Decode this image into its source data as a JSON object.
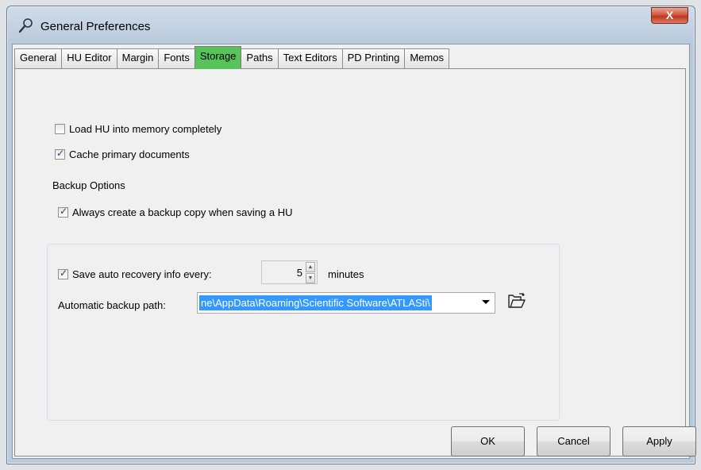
{
  "window": {
    "title": "General Preferences",
    "close_label": "X"
  },
  "tabs": [
    {
      "label": "General"
    },
    {
      "label": "HU Editor"
    },
    {
      "label": "Margin"
    },
    {
      "label": "Fonts"
    },
    {
      "label": "Storage",
      "active": true
    },
    {
      "label": "Paths"
    },
    {
      "label": "Text Editors"
    },
    {
      "label": "PD Printing"
    },
    {
      "label": "Memos"
    }
  ],
  "storage": {
    "load_hu": {
      "label": "Load HU into memory completely",
      "checked": false
    },
    "cache_docs": {
      "label": "Cache primary documents",
      "checked": true
    },
    "backup_group_label": "Backup Options",
    "always_backup": {
      "label": "Always create a backup copy when saving a HU",
      "checked": true
    },
    "auto_recovery": {
      "label": "Save auto recovery info every:",
      "checked": true
    },
    "auto_recovery_value": "5",
    "auto_recovery_unit": "minutes",
    "backup_path_label": "Automatic backup path:",
    "backup_path_value": "ne\\AppData\\Roaming\\Scientific Software\\ATLASti\\"
  },
  "buttons": {
    "ok": "OK",
    "cancel": "Cancel",
    "apply": "Apply"
  },
  "colors": {
    "active_tab": "#58c35a",
    "selection": "#3399ff",
    "close_button": "#c1361f"
  },
  "icons": {
    "title": "wrench-magnifier-icon",
    "browse": "open-folder-icon"
  }
}
